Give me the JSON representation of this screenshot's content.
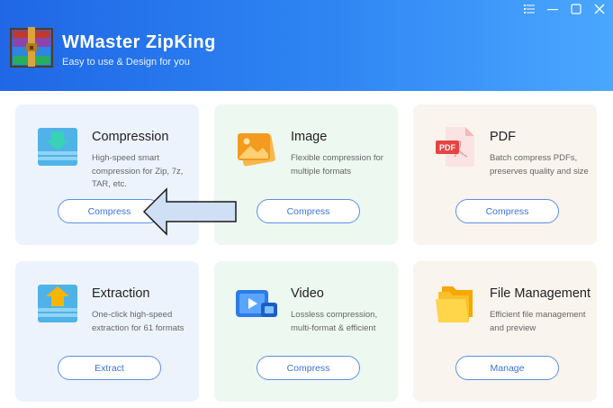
{
  "app": {
    "title": "WMaster ZipKing",
    "subtitle": "Easy to use & Design for you"
  },
  "window_controls": [
    {
      "name": "menu-icon"
    },
    {
      "name": "minimize-icon"
    },
    {
      "name": "maximize-icon"
    },
    {
      "name": "close-icon"
    }
  ],
  "cards": [
    {
      "title": "Compression",
      "description": "High-speed smart compression for Zip, 7z, TAR, etc.",
      "button": "Compress",
      "icon": "compression-icon"
    },
    {
      "title": "Image",
      "description": "Flexible compression for multiple formats",
      "button": "Compress",
      "icon": "image-icon"
    },
    {
      "title": "PDF",
      "description": "Batch compress PDFs, preserves quality and size",
      "button": "Compress",
      "icon": "pdf-icon"
    },
    {
      "title": "Extraction",
      "description": "One-click high-speed extraction for 61 formats",
      "button": "Extract",
      "icon": "extraction-icon"
    },
    {
      "title": "Video",
      "description": "Lossless compression, multi-format & efficient",
      "button": "Compress",
      "icon": "video-icon"
    },
    {
      "title": "File Management",
      "description": "Efficient file management and preview",
      "button": "Manage",
      "icon": "folder-icon"
    }
  ],
  "colors": {
    "header_start": "#1f67e6",
    "header_end": "#4aa7ff",
    "button_border": "#5b8fe6",
    "button_text": "#3d74d8"
  }
}
